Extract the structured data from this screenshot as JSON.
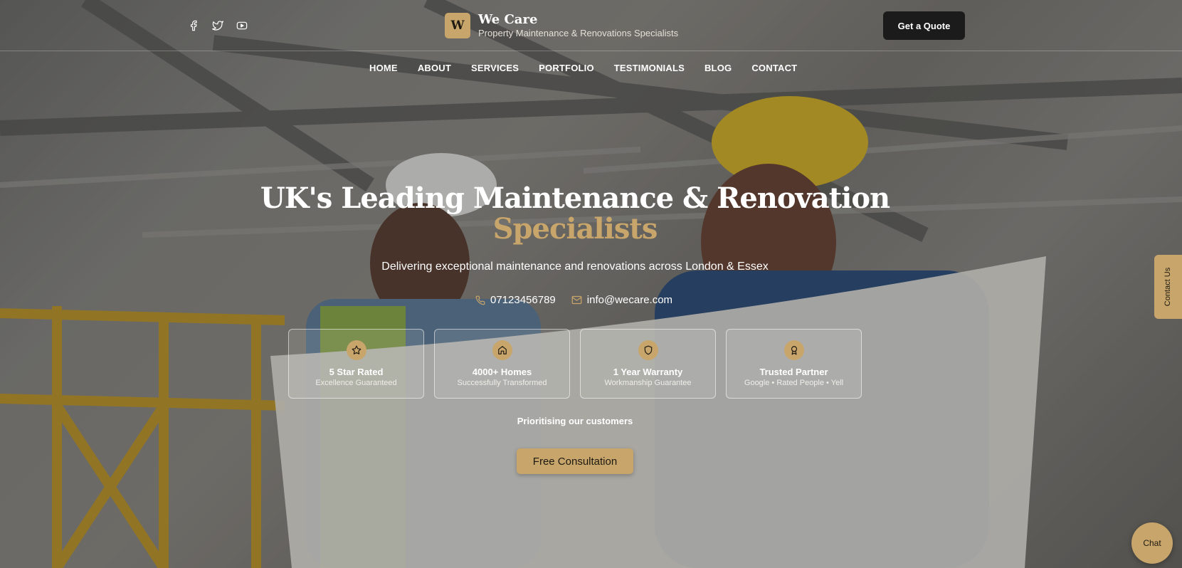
{
  "header": {
    "socials": [
      {
        "icon": "facebook-icon"
      },
      {
        "icon": "twitter-icon"
      },
      {
        "icon": "youtube-icon"
      }
    ],
    "logo_letter": "W",
    "brand_name": "We Care",
    "brand_tagline": "Property Maintenance & Renovations Specialists",
    "quote_button": "Get a Quote"
  },
  "nav": {
    "items": [
      "HOME",
      "ABOUT",
      "SERVICES",
      "PORTFOLIO",
      "TESTIMONIALS",
      "BLOG",
      "CONTACT"
    ]
  },
  "hero": {
    "title_line1": "UK's Leading Maintenance & Renovation",
    "title_line2": "Specialists",
    "subtitle": "Delivering exceptional maintenance and renovations across London & Essex",
    "phone": "07123456789",
    "email": "info@wecare.com",
    "features": [
      {
        "icon": "star-icon",
        "title": "5 Star Rated",
        "subtitle": "Excellence Guaranteed"
      },
      {
        "icon": "home-icon",
        "title": "4000+ Homes",
        "subtitle": "Successfully Transformed"
      },
      {
        "icon": "shield-icon",
        "title": "1 Year Warranty",
        "subtitle": "Workmanship Guarantee"
      },
      {
        "icon": "award-icon",
        "title": "Trusted Partner",
        "subtitle": "Google • Rated People • Yell"
      }
    ],
    "prioritising": "Prioritising our customers",
    "cta": "Free Consultation"
  },
  "side_tab": "Contact Us",
  "chat": "Chat",
  "colors": {
    "accent": "#c8a56a",
    "dark": "#1b1b1b"
  }
}
